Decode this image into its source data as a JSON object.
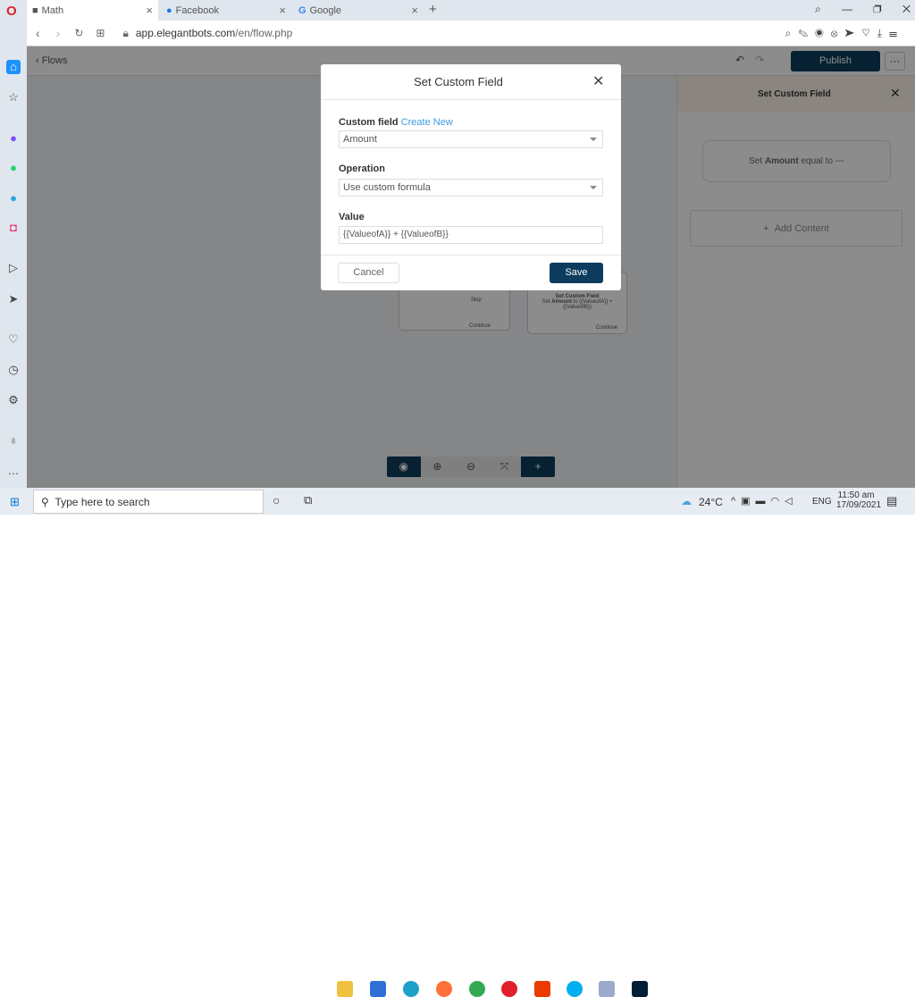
{
  "browser": {
    "tabs": [
      {
        "label": "Math",
        "active": true
      },
      {
        "label": "Facebook"
      },
      {
        "label": "Google"
      }
    ],
    "url_host": "app.elegantbots.com",
    "url_path": "/en/flow.php"
  },
  "page": {
    "back_label": "Flows",
    "publish_label": "Publish",
    "right_panel": {
      "title": "Set Custom Field",
      "summary_prefix": "Set ",
      "summary_field": "Amount",
      "summary_suffix": " equal to ---",
      "add_content": "Add Content"
    },
    "canvas": {
      "skip_label": "Skip",
      "continue_label": "Continue",
      "node_title": "Set Custom Field",
      "node_text_prefix": "Set ",
      "node_field": "Amount",
      "node_text_suffix": " to {{ValueofA}} + {{ValueofB}}",
      "node_continue": "Continue"
    }
  },
  "modal": {
    "title": "Set Custom Field",
    "custom_field_label": "Custom field",
    "create_new": "Create New",
    "custom_field_value": "Amount",
    "operation_label": "Operation",
    "operation_value": "Use custom formula",
    "value_label": "Value",
    "value_value": "{{ValueofA}} + {{ValueofB}}",
    "cancel": "Cancel",
    "save": "Save"
  },
  "taskbar": {
    "search_placeholder": "Type here to search",
    "weather": "24°C",
    "lang": "ENG",
    "time": "11:50 am",
    "date": "17/09/2021"
  },
  "colors": {
    "primary": "#0d3c5e",
    "link": "#3b9be0"
  }
}
